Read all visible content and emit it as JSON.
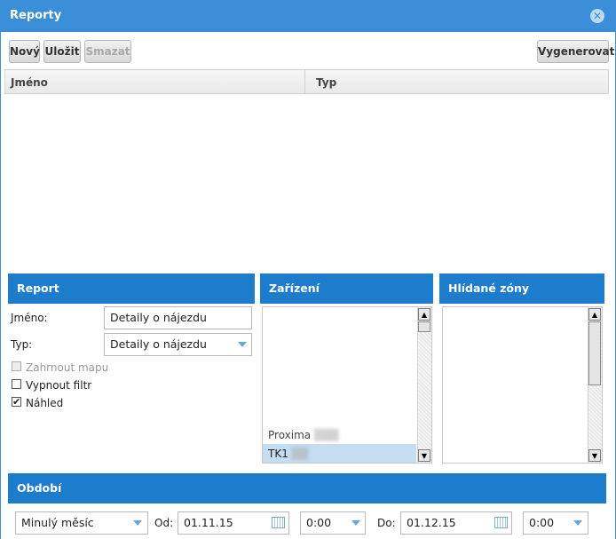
{
  "window": {
    "title": "Reporty",
    "close_icon": "close-icon"
  },
  "toolbar": {
    "new_label": "Nový",
    "save_label": "Uložit",
    "delete_label": "Smazat",
    "generate_label": "Vygenerovat"
  },
  "grid": {
    "columns": [
      "Jméno",
      "Typ"
    ]
  },
  "report_panel": {
    "title": "Report",
    "name_label": "Jméno:",
    "name_value": "Detaily o nájezdu",
    "type_label": "Typ:",
    "type_value": "Detaily o nájezdu",
    "include_map_label": "Zahrnout mapu",
    "disable_filter_label": "Vypnout filtr",
    "preview_label": "Náhled",
    "include_map_checked": false,
    "disable_filter_checked": false,
    "preview_checked": true
  },
  "devices_panel": {
    "title": "Zařízení",
    "items": [
      "",
      "",
      "",
      "",
      "",
      "",
      "Proxima",
      "TK1"
    ]
  },
  "zones_panel": {
    "title": "Hlídané zóny"
  },
  "period_panel": {
    "title": "Období",
    "period_value": "Minulý měsíc",
    "from_label": "Od:",
    "from_date": "01.11.15",
    "from_time": "0:00",
    "to_label": "Do:",
    "to_date": "01.12.15",
    "to_time": "0:00"
  },
  "colors": {
    "titlebar": "#3a8fd8",
    "panel_header": "#1e7ccc",
    "selection": "#c5ddf1"
  }
}
